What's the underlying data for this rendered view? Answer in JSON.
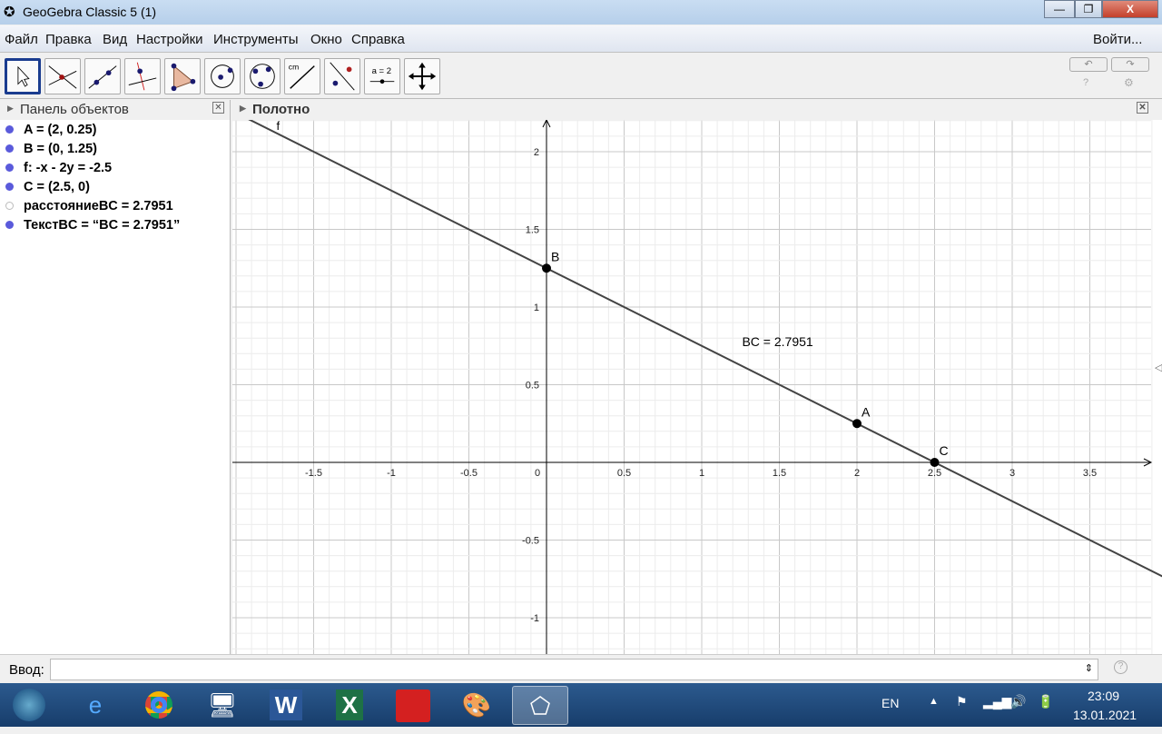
{
  "window": {
    "title": "GeoGebra Classic 5 (1)",
    "minimize": "—",
    "restore": "❐",
    "close": "X"
  },
  "menu": {
    "items": [
      "Файл",
      "Правка",
      "Вид",
      "Настройки",
      "Инструменты",
      "Окно",
      "Справка"
    ],
    "login": "Войти..."
  },
  "toolbar": {
    "tools": [
      "move",
      "intersect",
      "line-through-two-points",
      "perpendicular-line",
      "polygon",
      "circle-center-point",
      "circle-three-points",
      "distance",
      "reflect",
      "slider",
      "move-graphics-view"
    ],
    "undo": "↶",
    "redo": "↷",
    "help": "?",
    "settings": "⚙",
    "distance_label": "cm",
    "slider_label": "a = 2"
  },
  "algebra": {
    "title": "Панель объектов",
    "objects": [
      {
        "text": "A = (2, 0.25)",
        "visible": true
      },
      {
        "text": "B = (0, 1.25)",
        "visible": true
      },
      {
        "text": "f: -x - 2y = -2.5",
        "visible": true
      },
      {
        "text": "C = (2.5, 0)",
        "visible": true
      },
      {
        "text": "расстояниеBC = 2.7951",
        "visible": false
      },
      {
        "text": "ТекстBC = “BC = 2.7951”",
        "visible": true
      }
    ]
  },
  "graphics": {
    "title": "Полотно",
    "line_label": "f",
    "text_label": "BC = 2.7951",
    "points": [
      {
        "name": "A",
        "x": 2,
        "y": 0.25
      },
      {
        "name": "B",
        "x": 0,
        "y": 1.25
      },
      {
        "name": "C",
        "x": 2.5,
        "y": 0
      }
    ],
    "line": {
      "a": -1,
      "b": -2,
      "c": -2.5
    },
    "text_pos": {
      "x": 1.26,
      "y": 0.75
    },
    "x_ticks": [
      "-1.5",
      "-1",
      "-0.5",
      "0",
      "0.5",
      "1",
      "1.5",
      "2",
      "2.5",
      "3",
      "3.5"
    ],
    "y_ticks": [
      "2",
      "1.5",
      "1",
      "0.5",
      "-0.5",
      "-1"
    ]
  },
  "input": {
    "label": "Ввод:",
    "value": "",
    "help": "?"
  },
  "taskbar": {
    "lang": "EN",
    "time": "23:09",
    "date": "13.01.2021"
  }
}
